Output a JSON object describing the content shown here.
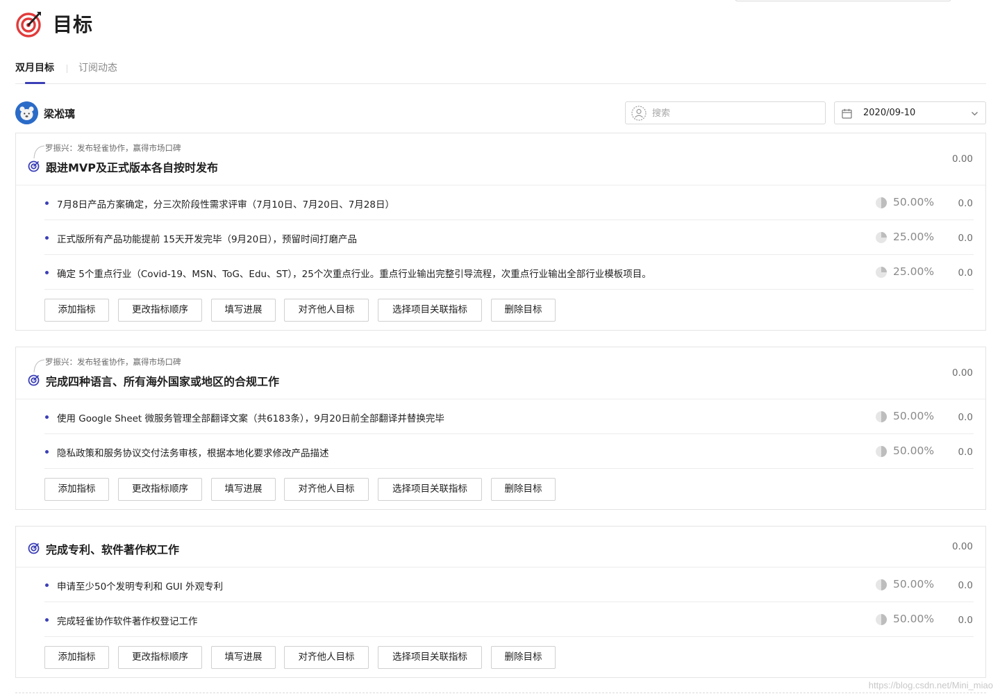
{
  "header": {
    "title": "目标",
    "logo_icon": "target-dart-icon"
  },
  "tabs": [
    {
      "label": "双月目标",
      "active": true
    },
    {
      "label": "订阅动态",
      "active": false
    }
  ],
  "user": {
    "name": "梁凇璃",
    "avatar_icon": "bear-avatar"
  },
  "search": {
    "placeholder": "搜索",
    "value": ""
  },
  "date_picker": {
    "value": "2020/09-10"
  },
  "actions": {
    "add_metric": "添加指标",
    "reorder_metrics": "更改指标顺序",
    "fill_progress": "填写进展",
    "align_goal": "对齐他人目标",
    "link_project": "选择项目关联指标",
    "delete_goal": "删除目标"
  },
  "goals": [
    {
      "parent": "罗振兴：发布轻雀协作，赢得市场口碑",
      "title": "跟进MVP及正式版本各自按时发布",
      "score": "0.00",
      "key_results": [
        {
          "text": "7月8日产品方案确定，分三次阶段性需求评审（7月10日、7月20日、7月28日）",
          "progress_label": "50.00%",
          "progress": 0.5,
          "score": "0.0"
        },
        {
          "text": "正式版所有产品功能提前 15天开发完毕（9月20日），预留时间打磨产品",
          "progress_label": "25.00%",
          "progress": 0.25,
          "score": "0.0"
        },
        {
          "text": "确定 5个重点行业（Covid-19、MSN、ToG、Edu、ST），25个次重点行业。重点行业输出完整引导流程，次重点行业输出全部行业模板项目。",
          "progress_label": "25.00%",
          "progress": 0.25,
          "score": "0.0"
        }
      ]
    },
    {
      "parent": "罗振兴：发布轻雀协作，赢得市场口碑",
      "title": "完成四种语言、所有海外国家或地区的合规工作",
      "score": "0.00",
      "key_results": [
        {
          "text": "使用 Google Sheet 微服务管理全部翻译文案（共6183条），9月20日前全部翻译并替换完毕",
          "progress_label": "50.00%",
          "progress": 0.5,
          "score": "0.0"
        },
        {
          "text": "隐私政策和服务协议交付法务审核，根据本地化要求修改产品描述",
          "progress_label": "50.00%",
          "progress": 0.5,
          "score": "0.0"
        }
      ]
    },
    {
      "parent": "",
      "title": "完成专利、软件著作权工作",
      "score": "0.00",
      "key_results": [
        {
          "text": "申请至少50个发明专利和 GUI 外观专利",
          "progress_label": "50.00%",
          "progress": 0.5,
          "score": "0.0"
        },
        {
          "text": "完成轻雀协作软件著作权登记工作",
          "progress_label": "50.00%",
          "progress": 0.5,
          "score": "0.0"
        }
      ]
    }
  ],
  "watermark": "https://blog.csdn.net/Mini_miao",
  "colors": {
    "accent": "#3b3fb6",
    "logo_red": "#e23b3b",
    "avatar_blue": "#2b6bc8",
    "muted": "#8a8a8a"
  }
}
